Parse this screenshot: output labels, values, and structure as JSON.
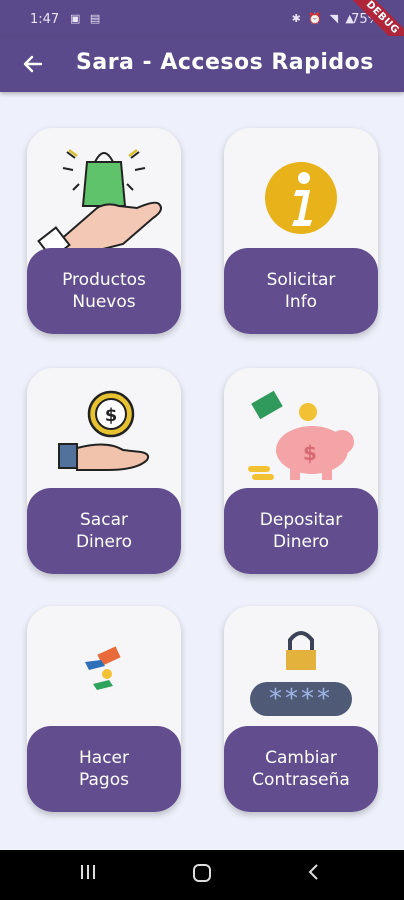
{
  "status_bar": {
    "time": "1:47",
    "battery": "75%",
    "debug_label": "DEBUG"
  },
  "app_bar": {
    "title": "Sara - Accesos Rapidos",
    "back_icon": "arrow-left-icon"
  },
  "cards": [
    {
      "line1": "Productos",
      "line2": "Nuevos",
      "icon": "hand-holding-shopping-bag-icon"
    },
    {
      "line1": "Solicitar",
      "line2": "Info",
      "icon": "info-icon"
    },
    {
      "line1": "Sacar",
      "line2": "Dinero",
      "icon": "hand-receiving-coin-icon"
    },
    {
      "line1": "Depositar",
      "line2": "Dinero",
      "icon": "piggy-bank-icon"
    },
    {
      "line1": "Hacer",
      "line2": "Pagos",
      "icon": "payment-exchange-icon"
    },
    {
      "line1": "Cambiar",
      "line2": "Contraseña",
      "icon": "password-lock-icon",
      "mask": "****"
    }
  ],
  "colors": {
    "primary": "#5b4a8b",
    "button": "#624d8f",
    "background": "#eef0fb"
  }
}
